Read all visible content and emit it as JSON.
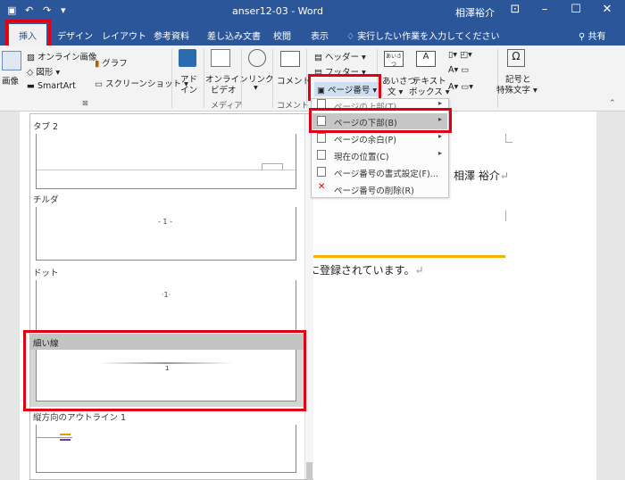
{
  "window": {
    "title": "anser12-03 - Word",
    "user": "相澤裕介",
    "qat_icons": [
      "save-icon",
      "undo-icon",
      "redo-icon",
      "customize-icon"
    ],
    "controls": [
      "ribbon-display-icon",
      "minimize-icon",
      "maximize-icon",
      "close-icon"
    ]
  },
  "tabs": {
    "insert": "挿入",
    "items": [
      "デザイン",
      "レイアウト",
      "参考資料",
      "差し込み文書",
      "校閲",
      "表示"
    ],
    "tell_me": "実行したい作業を入力してください",
    "share": "共有"
  },
  "ribbon": {
    "image_label": "画像",
    "online_image": "オンライン画像",
    "shapes": "図形",
    "smartart": "SmartArt",
    "graph": "グラフ",
    "screenshot": "スクリーンショット",
    "addin": [
      "アド",
      "イン"
    ],
    "online_video": [
      "オンライン",
      "ビデオ"
    ],
    "link": "リンク",
    "comment": "コメント",
    "header": "ヘッダー",
    "footer": "フッター",
    "page_number": "ページ番号",
    "textbox": [
      "あいさつ",
      "文"
    ],
    "textbox2": [
      "テキスト",
      "ボックス"
    ],
    "symbol": [
      "記号と",
      "特殊文字"
    ],
    "groups": {
      "media": "メディア",
      "comment": "コメント"
    }
  },
  "menu": {
    "items": [
      {
        "label": "ページの上部(T)",
        "arrow": "▸"
      },
      {
        "label": "ページの下部(B)",
        "arrow": "▸"
      },
      {
        "label": "ページの余白(P)",
        "arrow": "▸"
      },
      {
        "label": "現在の位置(C)",
        "arrow": "▸"
      },
      {
        "label": "ページ番号の書式設定(F)...",
        "arrow": ""
      },
      {
        "label": "ページ番号の削除(R)",
        "arrow": ""
      }
    ]
  },
  "gallery": {
    "items": [
      {
        "title": "タブ 2",
        "preview": ""
      },
      {
        "title": "チルダ",
        "preview": "- 1 -"
      },
      {
        "title": "ドット",
        "preview": "·1·"
      },
      {
        "title": "細い線",
        "preview": "1"
      },
      {
        "title": "縦方向のアウトライン 1",
        "preview": "1"
      }
    ]
  },
  "document": {
    "author": "相澤 裕介",
    "line": "に登録されています。"
  },
  "colors": {
    "accent": "#2b579a",
    "highlight": "#e00012",
    "rule": "#f2b400"
  }
}
